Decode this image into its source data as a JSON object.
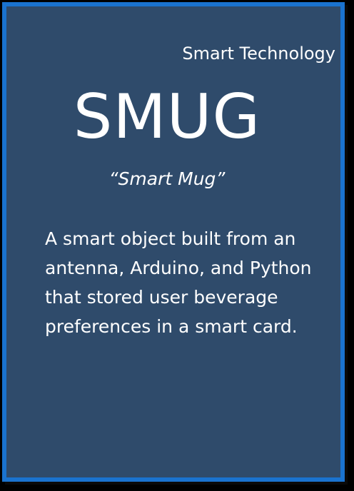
{
  "card": {
    "category": "Smart Technology",
    "title": "SMUG",
    "subtitle": "“Smart Mug”",
    "description": "A smart object built from an antenna, Arduino, and Python that stored user beverage preferences in a smart card."
  },
  "colors": {
    "background": "#000000",
    "card_fill": "#2f4b6b",
    "card_border": "#1a73cf",
    "text": "#ffffff"
  }
}
